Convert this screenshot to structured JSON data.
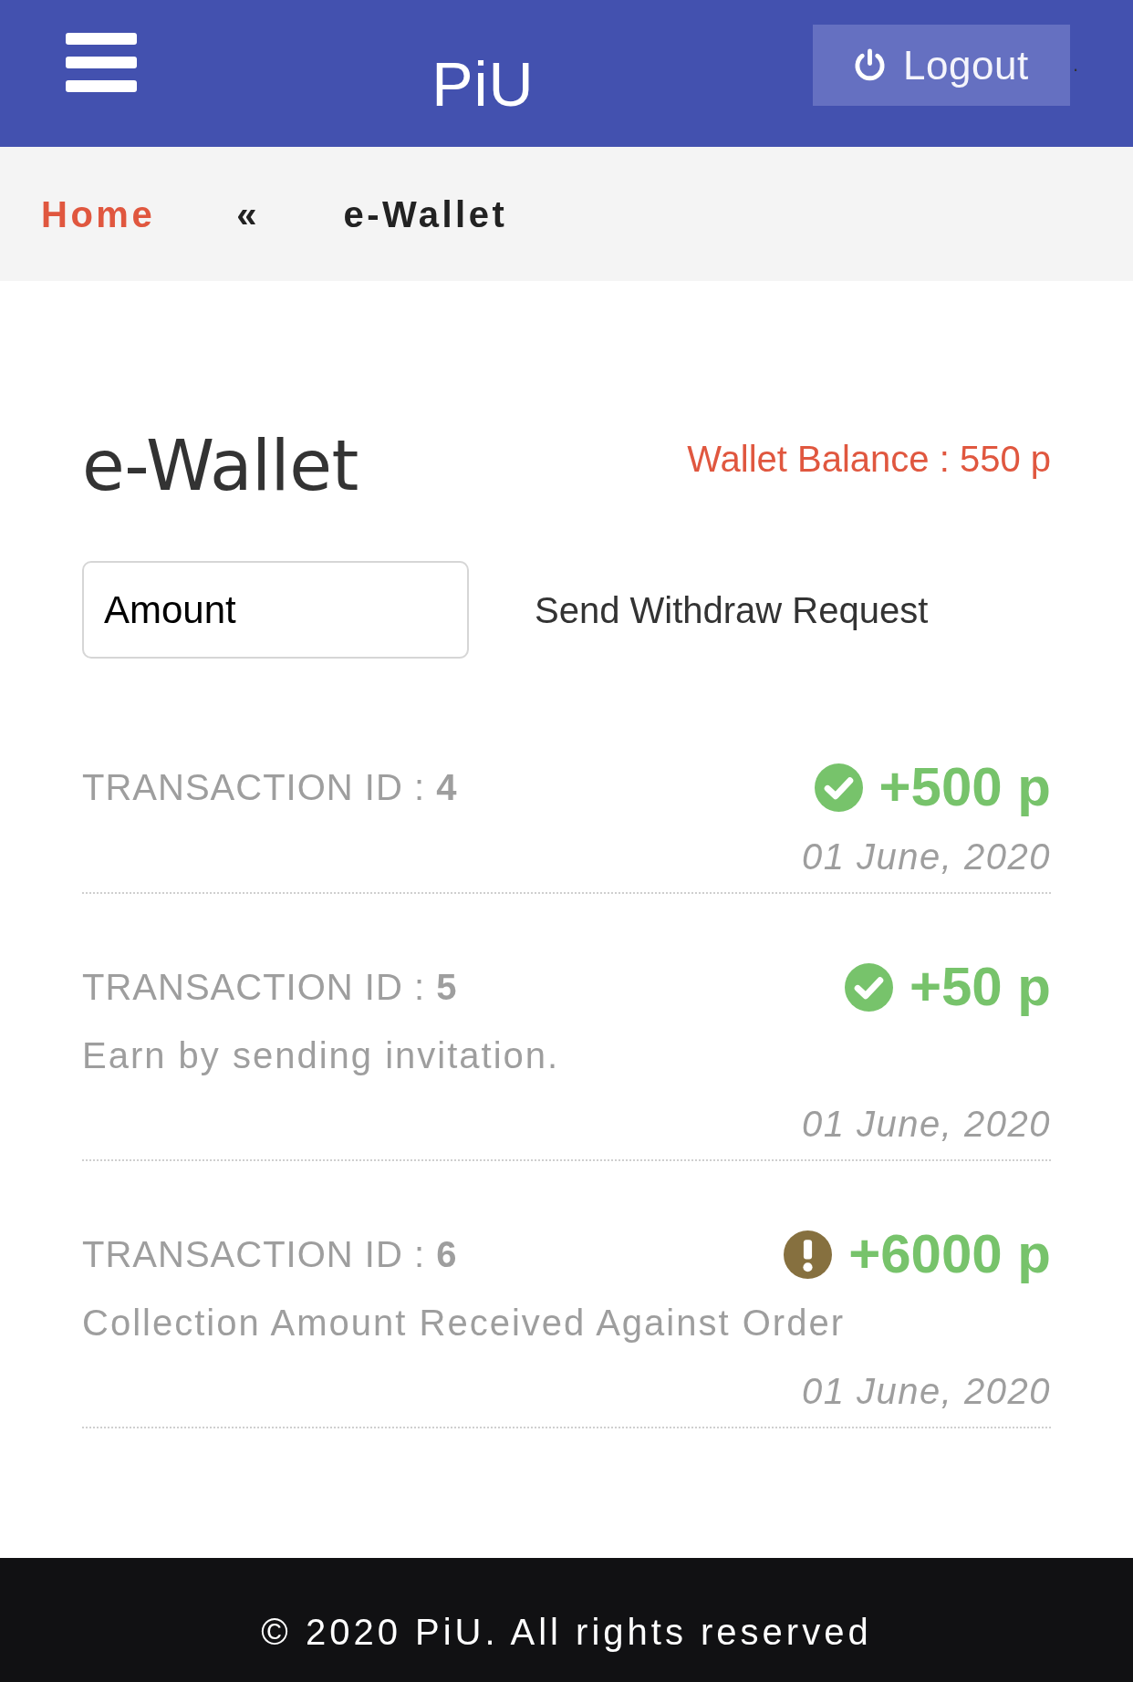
{
  "header": {
    "title": "PiU",
    "logout_button": "Logout",
    "trailing_text": "."
  },
  "breadcrumb": {
    "separator": "«",
    "items": [
      {
        "label": "Home",
        "current": false
      },
      {
        "label": "e-Wallet",
        "current": true
      }
    ]
  },
  "page": {
    "title": "e-Wallet",
    "wallet_balance": "Wallet Balance : 550 p"
  },
  "withdraw": {
    "amount_field": {
      "placeholder": "Amount"
    },
    "button": "Send Withdraw Request"
  },
  "transactions": [
    {
      "title": "TRANSACTION ID : **4**",
      "kind": "approved",
      "amount": "+500 p",
      "date": "01 June, 2020"
    },
    {
      "title": "TRANSACTION ID : **5**",
      "kind": "approved",
      "amount": "+50 p",
      "description": "Earn by sending invitation.",
      "date": "01 June, 2020"
    },
    {
      "title": "TRANSACTION ID : **6**",
      "kind": "pending",
      "amount": "+6000 p",
      "description": "Collection Amount Received Against Order",
      "date": "01 June, 2020"
    }
  ],
  "footer": {
    "copyright": "© 2020 PiU. All rights reserved"
  }
}
